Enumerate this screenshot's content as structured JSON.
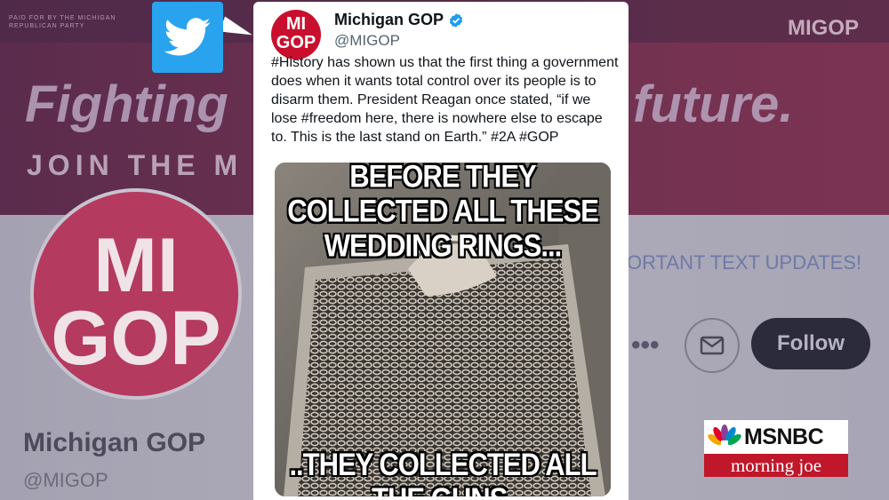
{
  "background": {
    "banner_small_text": "PAID FOR BY THE MICHIGAN REPUBLICAN PARTY",
    "banner_headline_left": "Fighting",
    "banner_headline_right": "future.",
    "banner_subline": "JOIN THE M",
    "banner_logo": "MIGOP",
    "avatar_line1": "MI",
    "avatar_line2": "GOP",
    "profile_name": "Michigan GOP",
    "profile_handle": "@MIGOP",
    "updates_text": "ORTANT TEXT UPDATES!",
    "more_label": "•••",
    "follow_label": "Follow"
  },
  "tweet": {
    "avatar_line1": "MI",
    "avatar_line2": "GOP",
    "author_name": "Michigan GOP",
    "author_handle": "@MIGOP",
    "text": "#History has shown us that the first thing a government does when it wants total control over its people is to disarm them. President Reagan once stated, “if we lose #freedom here, there is nowhere else to escape to. This is the last stand on Earth.” #2A #GOP",
    "meme_top": "BEFORE THEY COLLECTED ALL THESE WEDDING RINGS...",
    "meme_bottom": "..THEY COLLECTED ALL THE GUNS."
  },
  "network_bug": {
    "network": "MSNBC",
    "show": "morning joe"
  },
  "colors": {
    "twitter_blue": "#2aa3ef",
    "party_red": "#c8102e",
    "msnbc_red": "#c0172a",
    "verified_blue": "#1d9bf0"
  }
}
